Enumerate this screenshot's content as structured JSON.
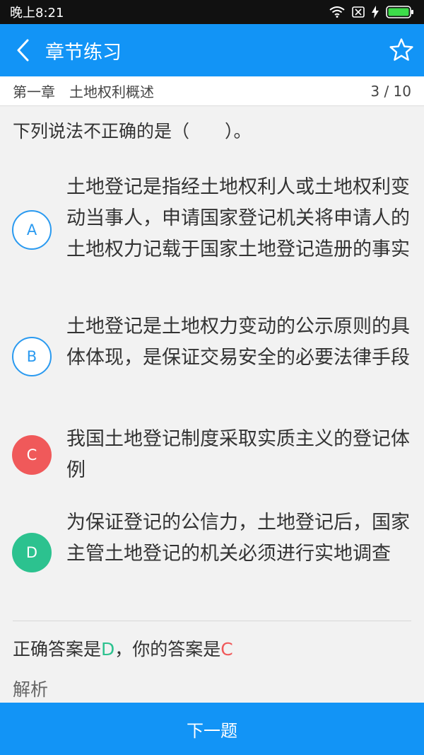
{
  "status": {
    "time": "晚上8:21"
  },
  "appbar": {
    "title": "章节练习"
  },
  "chapter": {
    "name": "第一章　土地权利概述",
    "progress": "3 / 10"
  },
  "question": {
    "text": "下列说法不正确的是（　　）。"
  },
  "options": [
    {
      "letter": "A",
      "text": "土地登记是指经土地权利人或土地权利变动当事人，申请国家登记机关将申请人的土地权力记载于国家土地登记造册的事实"
    },
    {
      "letter": "B",
      "text": "土地登记是土地权力变动的公示原则的具体体现，是保证交易安全的必要法律手段"
    },
    {
      "letter": "C",
      "text": "我国土地登记制度采取实质主义的登记体例"
    },
    {
      "letter": "D",
      "text": "为保证登记的公信力，土地登记后，国家主管土地登记的机关必须进行实地调查"
    }
  ],
  "answer": {
    "correct_prefix": "正确答案是",
    "correct": "D",
    "mid": "，你的答案是",
    "yours": "C"
  },
  "analysis": {
    "label": "解析"
  },
  "next": {
    "label": "下一题"
  },
  "colors": {
    "primary": "#1294f6",
    "correct": "#2cc28f",
    "wrong": "#f0595a"
  }
}
